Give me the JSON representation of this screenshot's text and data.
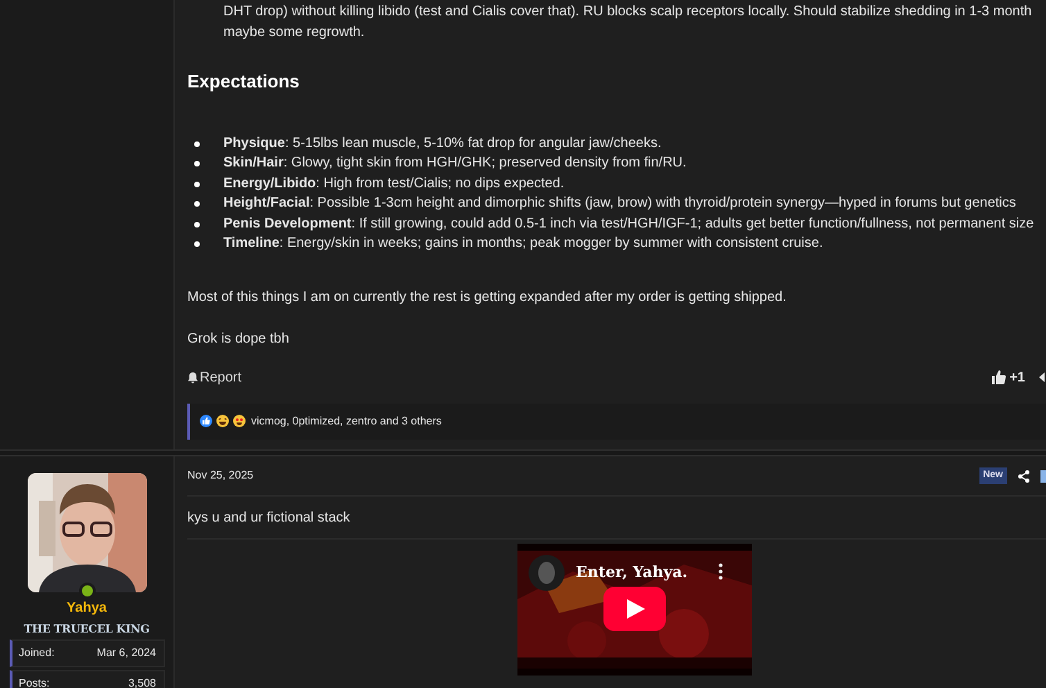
{
  "post_1": {
    "body_lines": [
      "DHT drop) without killing libido (test and Cialis cover that). RU blocks scalp receptors locally. Should stabilize shedding in 1-3 month",
      "maybe some regrowth."
    ],
    "heading": "Expectations",
    "bullets": [
      {
        "term": "Physique",
        "text": ": 5-15lbs lean muscle, 5-10% fat drop for angular jaw/cheeks."
      },
      {
        "term": "Skin/Hair",
        "text": ": Glowy, tight skin from HGH/GHK; preserved density from fin/RU."
      },
      {
        "term": "Energy/Libido",
        "text": ": High from test/Cialis; no dips expected."
      },
      {
        "term": "Height/Facial",
        "text": ": Possible 1-3cm height and dimorphic shifts (jaw, brow) with thyroid/protein synergy—hyped in forums but genetics"
      },
      {
        "term": "Penis Development",
        "text": ": If still growing, could add 0.5-1 inch via test/HGH/IGF-1; adults get better function/fullness, not permanent size"
      },
      {
        "term": "Timeline",
        "text": ": Energy/skin in weeks; gains in months; peak mogger by summer with consistent cruise."
      }
    ],
    "paragraphs": [
      "Most of this things I am on currently the rest is getting expanded after my order is getting shipped.",
      "Grok is dope tbh"
    ],
    "report_label": "Report",
    "like_count": "+1",
    "reactions": {
      "icons": [
        {
          "kind": "like"
        },
        {
          "kind": "haha"
        },
        {
          "kind": "love"
        }
      ],
      "text": "vicmog, 0ptimized, zentro and 3 others"
    }
  },
  "post_2": {
    "user": {
      "name": "Yahya",
      "title": "THE TRUECEL KING",
      "online": true,
      "stats": [
        {
          "label": "Joined:",
          "value": "Mar 6, 2024"
        },
        {
          "label": "Posts:",
          "value": "3,508"
        }
      ]
    },
    "date": "Nov 25, 2025",
    "badge": "New",
    "text": "kys u and ur fictional stack",
    "video": {
      "kind": "picture",
      "title": "Enter, Yahya."
    }
  }
}
